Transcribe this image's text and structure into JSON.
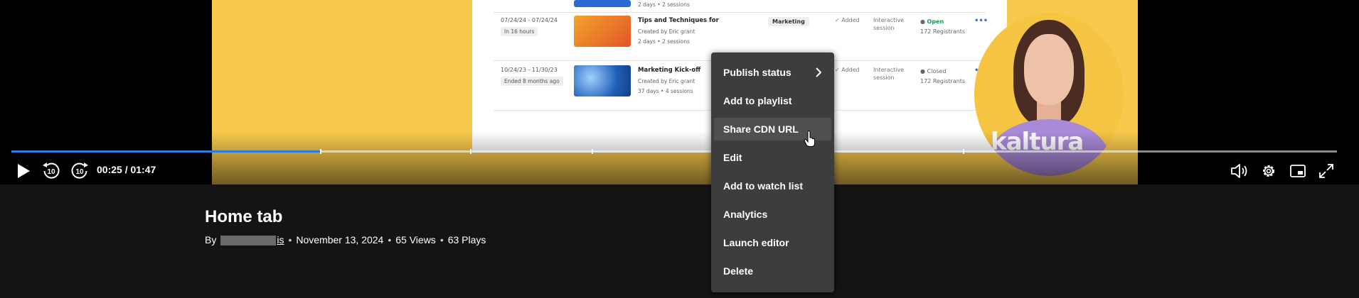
{
  "player": {
    "time_display": "00:25 / 01:47",
    "progress_fraction": 0.233,
    "chapter_marks_fraction": [
      0.233,
      0.346,
      0.438,
      0.718
    ],
    "accent_color": "#2e7ddb",
    "controls": {
      "play": "play-icon",
      "rewind": "rewind-10-icon",
      "forward": "forward-10-icon",
      "volume": "volume-icon",
      "settings": "gear-icon",
      "pip": "picture-in-picture-icon",
      "fullscreen": "fullscreen-icon"
    },
    "rewind_seconds": "10",
    "forward_seconds": "10",
    "brand_text": "kaltura",
    "video_content": {
      "rows": [
        {
          "dates": "07/24/24 - 07/24/24",
          "pill": "In 16 hours",
          "title": "Tips and Techniques for",
          "created_by": "Created by Eric grant",
          "sessions": "2 days  •  2 sessions",
          "tag": "Marketing",
          "added": "✓ Added",
          "type_line1": "Interactive",
          "type_line2": "session",
          "status": "Open",
          "registrants": "172 Registrants"
        },
        {
          "dates": "10/24/23 - 11/30/23",
          "pill": "Ended 8 months ago",
          "title": "Marketing Kick-off",
          "created_by": "Created by Eric grant",
          "sessions": "37 days  •  4 sessions",
          "tag": "",
          "added": "✓ Added",
          "type_line1": "Interactive",
          "type_line2": "session",
          "status": "Closed",
          "registrants": "172 Registrants"
        }
      ],
      "top_fragment": "2 days  •  2 sessions"
    }
  },
  "entry": {
    "title": "Home tab",
    "by_label": "By",
    "author_visible_suffix": "is",
    "date": "November 13, 2024",
    "views": "65 Views",
    "plays": "63 Plays",
    "separator": "•"
  },
  "context_menu": {
    "items": [
      {
        "label": "Publish status",
        "has_submenu": true
      },
      {
        "label": "Add to playlist"
      },
      {
        "label": "Share CDN URL",
        "hovered": true
      },
      {
        "label": "Edit"
      },
      {
        "label": "Add to watch list"
      },
      {
        "label": "Analytics"
      },
      {
        "label": "Launch editor"
      },
      {
        "label": "Delete"
      }
    ]
  }
}
